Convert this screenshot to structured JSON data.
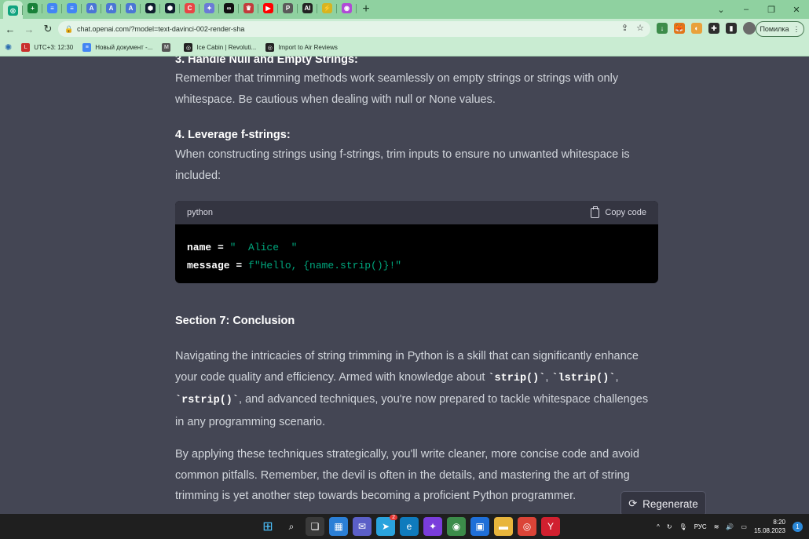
{
  "browser": {
    "tabs": [
      {
        "icon": "chatgpt-icon",
        "color": "#10a37f",
        "glyph": "◎",
        "active": true
      },
      {
        "icon": "sheets-icon",
        "color": "#188038",
        "glyph": "+"
      },
      {
        "icon": "docs-icon",
        "color": "#4285f4",
        "glyph": "≡"
      },
      {
        "icon": "docs-icon",
        "color": "#4285f4",
        "glyph": "≡"
      },
      {
        "icon": "translate-icon",
        "color": "#4a76d4",
        "glyph": "A"
      },
      {
        "icon": "translate-icon",
        "color": "#4a76d4",
        "glyph": "A"
      },
      {
        "icon": "translate-icon",
        "color": "#4a76d4",
        "glyph": "A"
      },
      {
        "icon": "hex-icon",
        "color": "#0f1f2e",
        "glyph": "⬢"
      },
      {
        "icon": "hex-icon",
        "color": "#0f1f2e",
        "glyph": "⬢"
      },
      {
        "icon": "copyleaks-icon",
        "color": "#e84545",
        "glyph": "C"
      },
      {
        "icon": "feather-icon",
        "color": "#6a7bd6",
        "glyph": "✦"
      },
      {
        "icon": "glasses-icon",
        "color": "#111111",
        "glyph": "∞"
      },
      {
        "icon": "crown-icon",
        "color": "#c23b3b",
        "glyph": "♛"
      },
      {
        "icon": "youtube-icon",
        "color": "#ff0000",
        "glyph": "▶"
      },
      {
        "icon": "p-icon",
        "color": "#5a5a5a",
        "glyph": "P"
      },
      {
        "icon": "ai-icon",
        "color": "#222222",
        "glyph": "AI"
      },
      {
        "icon": "bolt-icon",
        "color": "#d6b421",
        "glyph": "⚡"
      },
      {
        "icon": "colorful-icon",
        "color": "#b04ad6",
        "glyph": "◉"
      }
    ],
    "url": "chat.openai.com/?model=text-davinci-002-render-sha",
    "error_button": "Помилка",
    "bookmarks": [
      {
        "icon": "lastpass-icon",
        "color": "#c9302c",
        "glyph": "L",
        "label": "UTC+3: 12:30"
      },
      {
        "icon": "docs-icon",
        "color": "#4285f4",
        "glyph": "≡",
        "label": "Новый документ -..."
      },
      {
        "icon": "monitor-icon",
        "color": "#555555",
        "glyph": "M",
        "label": ""
      },
      {
        "icon": "openai-icon",
        "color": "#222222",
        "glyph": "◎",
        "label": "Ice Cabin | Revoluti..."
      },
      {
        "icon": "openai-icon",
        "color": "#222222",
        "glyph": "◎",
        "label": "Import to Air Reviews"
      }
    ]
  },
  "article": {
    "partial_heading": "3. Handle Null and Empty Strings:",
    "para1": "Remember that trimming methods work seamlessly on empty strings or strings with only whitespace. Be cautious when dealing with null or None values.",
    "heading4": "4. Leverage f-strings:",
    "para2": "When constructing strings using f-strings, trim inputs to ensure no unwanted whitespace is included:",
    "code": {
      "language": "python",
      "copy_label": "Copy code",
      "line1_var": "name",
      "line1_op": " = ",
      "line1_str": "\"  Alice  \"",
      "line2_var": "message",
      "line2_op": " = ",
      "line2_str": "f\"Hello, {name.strip()}!\""
    },
    "section_heading": "Section 7: Conclusion",
    "para3_a": "Navigating the intricacies of string trimming in Python is a skill that can significantly enhance your code quality and efficiency. Armed with knowledge about ",
    "para3_code1": "`strip()`",
    "para3_b": ", ",
    "para3_code2": "`lstrip()`",
    "para3_c": ", ",
    "para3_code3": "`rstrip()`",
    "para3_d": ", and advanced techniques, you're now prepared to tackle whitespace challenges in any programming scenario.",
    "para4": "By applying these techniques strategically, you'll write cleaner, more concise code and avoid common pitfalls. Remember, the devil is often in the details, and mastering the art of string trimming is yet another step towards becoming a proficient Python programmer.",
    "regenerate_label": "Regenerate"
  },
  "taskbar": {
    "lang": "РУС",
    "time": "8:20",
    "date": "15.08.2023",
    "notifications": "1",
    "telegram_badge": "2"
  }
}
